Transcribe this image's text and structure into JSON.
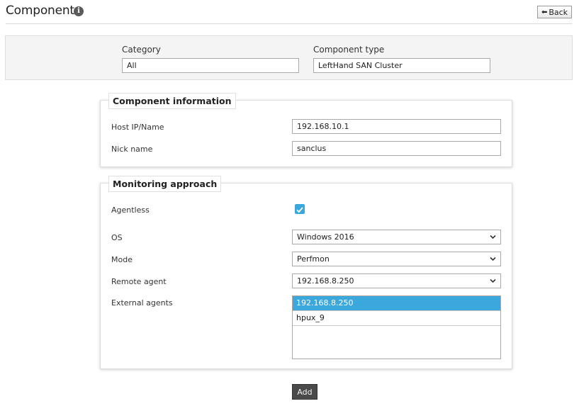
{
  "header": {
    "title": "Component",
    "info_icon": "info-icon",
    "back_label": "Back",
    "back_icon": "arrow-back-icon"
  },
  "filters": {
    "category_label": "Category",
    "category_value": "All",
    "component_type_label": "Component type",
    "component_type_value": "LeftHand SAN Cluster"
  },
  "component_info": {
    "legend": "Component information",
    "host_label": "Host IP/Name",
    "host_value": "192.168.10.1",
    "nick_label": "Nick name",
    "nick_value": "sanclus"
  },
  "monitoring": {
    "legend": "Monitoring approach",
    "agentless_label": "Agentless",
    "agentless_checked": true,
    "os_label": "OS",
    "os_value": "Windows 2016",
    "mode_label": "Mode",
    "mode_value": "Perfmon",
    "remote_agent_label": "Remote agent",
    "remote_agent_value": "192.168.8.250",
    "external_agents_label": "External agents",
    "external_agents": [
      {
        "label": "192.168.8.250",
        "selected": true
      },
      {
        "label": "hpux_9",
        "selected": false
      }
    ]
  },
  "actions": {
    "add_label": "Add"
  },
  "colors": {
    "accent": "#3aa7dd",
    "add_button": "#4a4a4a"
  }
}
